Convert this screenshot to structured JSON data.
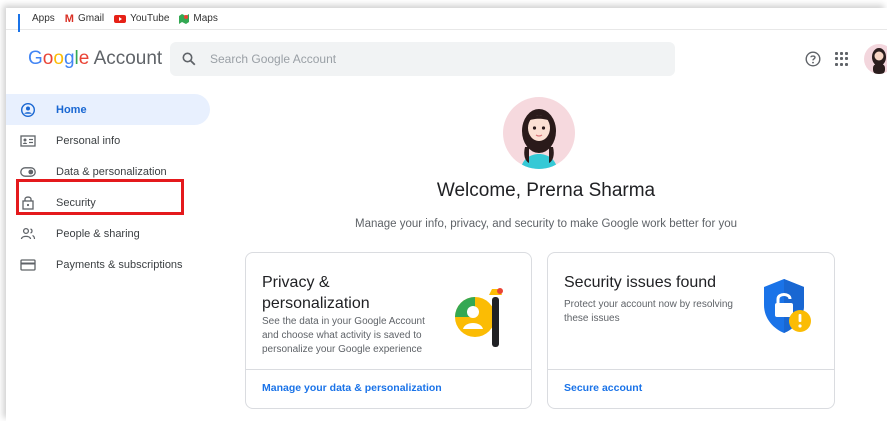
{
  "bookmarks": [
    {
      "label": "Apps",
      "icon": "apps-icon"
    },
    {
      "label": "Gmail",
      "icon": "gmail-icon"
    },
    {
      "label": "YouTube",
      "icon": "youtube-icon"
    },
    {
      "label": "Maps",
      "icon": "maps-icon"
    }
  ],
  "header": {
    "logo_google": [
      "G",
      "o",
      "o",
      "g",
      "l",
      "e"
    ],
    "logo_account": "Account",
    "search_placeholder": "Search Google Account"
  },
  "sidebar": {
    "items": [
      {
        "label": "Home",
        "icon": "home-icon",
        "active": true
      },
      {
        "label": "Personal info",
        "icon": "id-card-icon"
      },
      {
        "label": "Data & personalization",
        "icon": "toggle-icon"
      },
      {
        "label": "Security",
        "icon": "lock-icon"
      },
      {
        "label": "People & sharing",
        "icon": "people-icon"
      },
      {
        "label": "Payments & subscriptions",
        "icon": "credit-card-icon"
      }
    ]
  },
  "main": {
    "welcome": "Welcome, Prerna Sharma",
    "subtitle": "Manage your info, privacy, and security to make Google work better for you",
    "cards": [
      {
        "title": "Privacy & personalization",
        "desc": "See the data in your Google Account and choose what activity is saved to personalize your Google experience",
        "link": "Manage your data & personalization"
      },
      {
        "title": "Security issues found",
        "desc": "Protect your account now by resolving these issues",
        "link": "Secure account"
      }
    ]
  },
  "colors": {
    "accent": "#1a73e8",
    "active_bg": "#e8f0fe",
    "highlight": "#e4191c"
  }
}
